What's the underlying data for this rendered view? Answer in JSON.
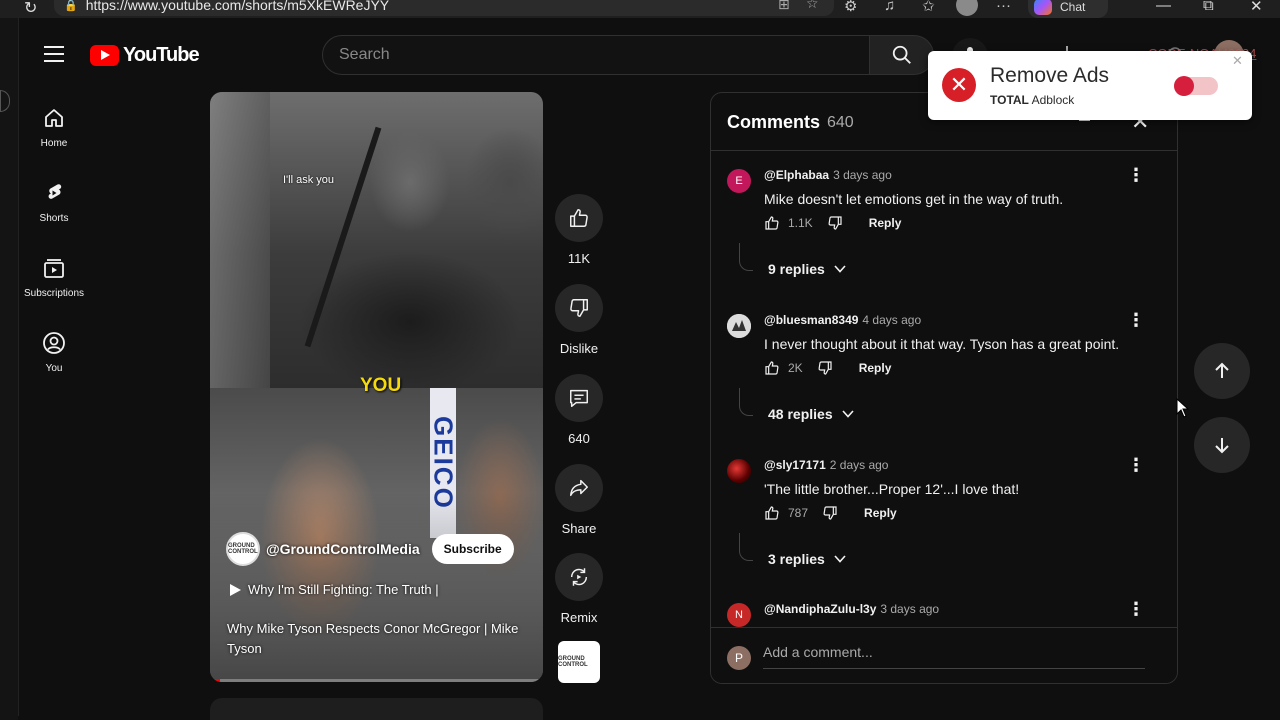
{
  "browser": {
    "url": "https://www.youtube.com/shorts/m5XkEWReJYY",
    "chat_label": "Chat"
  },
  "header": {
    "logo_text": "YouTube",
    "search_placeholder": "Search",
    "code_text": "CODE-NOAH6624"
  },
  "sidebar": {
    "items": [
      {
        "label": "Home",
        "icon": "home-icon"
      },
      {
        "label": "Shorts",
        "icon": "shorts-icon"
      },
      {
        "label": "Subscriptions",
        "icon": "subscriptions-icon"
      },
      {
        "label": "You",
        "icon": "you-icon"
      }
    ]
  },
  "video": {
    "caption_top": "I'll ask you",
    "caption_bottom": "YOU",
    "banner_text": "GEICO",
    "channel": "@GroundControlMedia",
    "channel_avatar_text": "GROUND CONTROL",
    "subscribe_label": "Subscribe",
    "title_line1": "Why I'm Still Fighting: The Truth |",
    "title_line2": "Why Mike Tyson Respects Conor McGregor | Mike Tyson",
    "progress": 0.03
  },
  "actions": {
    "like_count": "11K",
    "dislike_label": "Dislike",
    "comment_count": "640",
    "share_label": "Share",
    "remix_label": "Remix"
  },
  "comments": {
    "title": "Comments",
    "count": "640",
    "items": [
      {
        "avatar_letter": "E",
        "avatar_color": "#c2185b",
        "author": "@Elphabaa",
        "time": "3 days ago",
        "text": "Mike doesn't let emotions get in the way of truth.",
        "likes": "1.1K",
        "reply_label": "Reply",
        "replies": "9 replies"
      },
      {
        "avatar_letter": "",
        "avatar_color": "#e0e0e0",
        "author": "@bluesman8349",
        "time": "4 days ago",
        "text": "I never thought about it that way. Tyson has a great point.",
        "likes": "2K",
        "reply_label": "Reply",
        "replies": "48 replies"
      },
      {
        "avatar_letter": "",
        "avatar_color": "#8b0000",
        "author": "@sly17171",
        "time": "2 days ago",
        "text": "'The little brother...Proper 12'...I love that!",
        "likes": "787",
        "reply_label": "Reply",
        "replies": "3 replies"
      },
      {
        "avatar_letter": "N",
        "avatar_color": "#c62828",
        "author": "@NandiphaZulu-l3y",
        "time": "3 days ago"
      }
    ],
    "my_avatar_letter": "P",
    "add_placeholder": "Add a comment..."
  },
  "popup": {
    "title": "Remove Ads",
    "brand_bold": "TOTAL",
    "brand_rest": " Adblock",
    "toggle_on": false
  }
}
